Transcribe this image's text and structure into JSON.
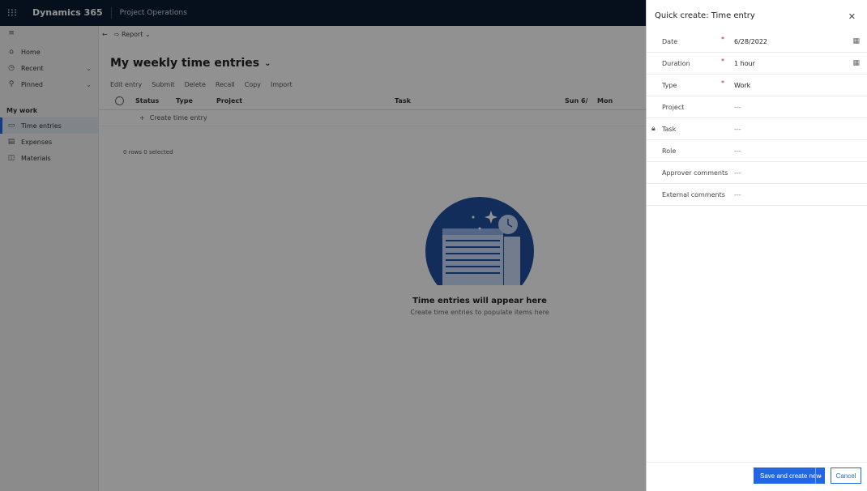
{
  "topbar": {
    "brand": "Dynamics 365",
    "app": "Project Operations"
  },
  "sidebar": {
    "items": [
      {
        "label": "Home",
        "icon": "home-icon"
      },
      {
        "label": "Recent",
        "icon": "clock-icon"
      },
      {
        "label": "Pinned",
        "icon": "pin-icon"
      }
    ],
    "section": "My work",
    "work_items": [
      {
        "label": "Time entries",
        "icon": "calendar-icon",
        "active": true
      },
      {
        "label": "Expenses",
        "icon": "receipt-icon"
      },
      {
        "label": "Materials",
        "icon": "box-icon"
      }
    ]
  },
  "main": {
    "cmd1": {
      "report": "Report"
    },
    "title": "My weekly time entries",
    "toolbar": [
      "Edit entry",
      "Submit",
      "Delete",
      "Recall",
      "Copy",
      "Import"
    ],
    "columns": [
      "Status",
      "Type",
      "Project",
      "Task",
      "Sun 6/",
      "Mon"
    ],
    "create_label": "Create time entry",
    "selected_text": "0 rows 0 selected",
    "empty_title": "Time entries will appear here",
    "empty_sub": "Create time entries to populate items here"
  },
  "panel": {
    "title": "Quick create: Time entry",
    "fields": [
      {
        "label": "Date",
        "value": "6/28/2022",
        "required": true,
        "calendar": true
      },
      {
        "label": "Duration",
        "value": "1 hour",
        "required": true,
        "calendar": true
      },
      {
        "label": "Type",
        "value": "Work",
        "required": true
      },
      {
        "label": "Project",
        "value": "---"
      },
      {
        "label": "Task",
        "value": "---",
        "locked": true
      },
      {
        "label": "Role",
        "value": "---"
      },
      {
        "label": "Approver comments",
        "value": "---"
      },
      {
        "label": "External comments",
        "value": "---"
      }
    ],
    "save_label": "Save and create new",
    "cancel_label": "Cancel"
  }
}
